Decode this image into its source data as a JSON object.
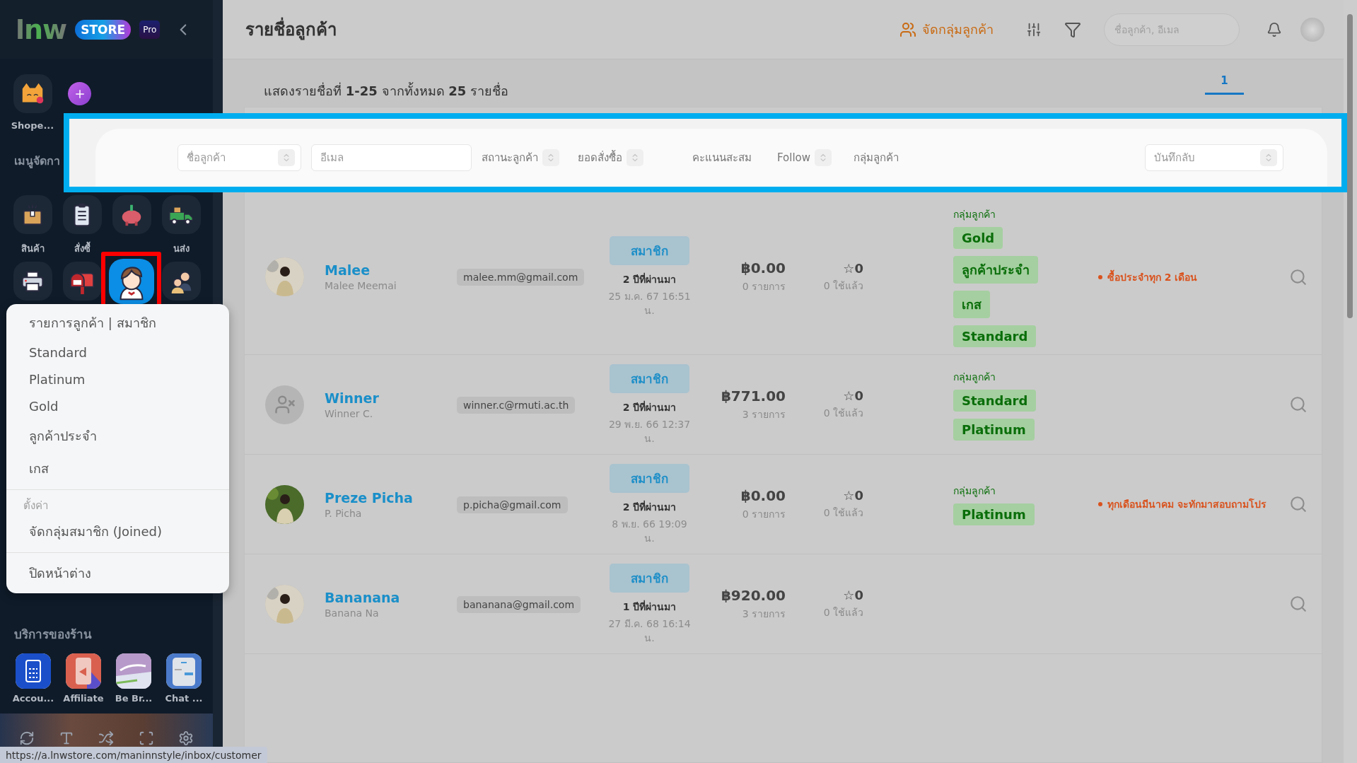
{
  "sidebar": {
    "logo": {
      "wordmark": "lnw",
      "badge": "STORE",
      "plan": "Pro"
    },
    "shops": [
      {
        "label": "Shope..."
      }
    ],
    "section_title": "เมนูจัดกา",
    "menu_icons": [
      {
        "kind": "box",
        "label": "สินค้า",
        "highlighted": false
      },
      {
        "kind": "clipboard",
        "label": "สั่งซื้",
        "highlighted": false
      },
      {
        "kind": "piggy",
        "highlighted": false
      },
      {
        "kind": "truck",
        "label": "นส่ง",
        "highlighted": false
      },
      {
        "kind": "printer",
        "highlighted": false
      },
      {
        "kind": "mailbox",
        "highlighted": false
      },
      {
        "kind": "customer",
        "highlighted": true
      },
      {
        "kind": "team",
        "highlighted": false
      }
    ],
    "services_title": "บริการของร้าน",
    "services": [
      {
        "kind": "calculator",
        "label": "Accou..."
      },
      {
        "kind": "megaphone",
        "label": "Affiliate"
      },
      {
        "kind": "brand",
        "label": "Be Br..."
      },
      {
        "kind": "chat",
        "label": "Chat ..."
      }
    ],
    "tools": [
      {
        "kind": "refresh"
      },
      {
        "kind": "text-size"
      },
      {
        "kind": "shuffle"
      },
      {
        "kind": "fullscreen"
      },
      {
        "kind": "settings"
      }
    ]
  },
  "popup_menu": {
    "items": [
      "รายการลูกค้า | สมาชิก",
      "Standard",
      "Platinum",
      "Gold",
      "ลูกค้าประจำ",
      "เกส"
    ],
    "section_title": "ตั้งค่า",
    "section_items": [
      "จัดกลุ่มสมาชิก (Joined)"
    ],
    "footer_item": "ปิดหน้าต่าง"
  },
  "status_url": "https://a.lnwstore.com/maninnstyle/inbox/customer",
  "header": {
    "title": "รายชื่อลูกค้า",
    "group_button": "จัดกลุ่มลูกค้า",
    "search_placeholder": "ชื่อลูกค้า, อีเมล"
  },
  "summary": "แสดงรายชื่อที่ **1-25** จากทั้งหมด **25** รายชื่อ",
  "pages": [
    {
      "label": "1",
      "selected": true
    }
  ],
  "columns_header": {
    "highlighted": true,
    "columns": [
      {
        "label": "ชื่อลูกค้า",
        "kind": "input",
        "sortable": true
      },
      {
        "label": "อีเมล",
        "kind": "input",
        "sortable": false
      },
      {
        "label": "สถานะลูกค้า",
        "kind": "label",
        "sortable": true
      },
      {
        "label": "ยอดสั่งซื้อ",
        "kind": "label",
        "sortable": true
      },
      {
        "label": "คะแนนสะสม",
        "kind": "label",
        "sortable": false
      },
      {
        "label": "Follow",
        "kind": "label",
        "sortable": true
      },
      {
        "label": "กลุ่มลูกค้า",
        "kind": "label",
        "sortable": false
      },
      {
        "label": "บันทึกลับ",
        "kind": "input",
        "sortable": true
      }
    ]
  },
  "rows": [
    {
      "avatar": {
        "kind": "picture"
      },
      "name": "Malee",
      "username": "Malee Meemai",
      "email": "malee.mm@gmail.com",
      "status": "สมาชิก",
      "since": "2 ปีที่ผ่านมา",
      "date": "25 ม.ค. 67 16:51 น.",
      "amount": "฿0.00",
      "orders": "0 รายการ",
      "points": "☆0",
      "used": "0 ใช้แล้ว",
      "group_label": "กลุ่มลูกค้า",
      "groups": [
        "Gold",
        "ลูกค้าประจำ",
        "เกส",
        "Standard"
      ],
      "note": "ซื้อประจำทุก 2 เดือน"
    },
    {
      "avatar": {
        "kind": "placeholder"
      },
      "name": "Winner",
      "username": "Winner C.",
      "email": "winner.c@rmuti.ac.th",
      "status": "สมาชิก",
      "since": "2 ปีที่ผ่านมา",
      "date": "29 พ.ย. 66 12:37 น.",
      "amount": "฿771.00",
      "orders": "3 รายการ",
      "points": "☆0",
      "used": "0 ใช้แล้ว",
      "group_label": "กลุ่มลูกค้า",
      "groups": [
        "Standard",
        "Platinum"
      ]
    },
    {
      "avatar": {
        "kind": "picture"
      },
      "name": "Preze Picha",
      "username": "P. Picha",
      "email": "p.picha@gmail.com",
      "status": "สมาชิก",
      "since": "2 ปีที่ผ่านมา",
      "date": "8 พ.ย. 66 19:09 น.",
      "amount": "฿0.00",
      "orders": "0 รายการ",
      "points": "☆0",
      "used": "0 ใช้แล้ว",
      "group_label": "กลุ่มลูกค้า",
      "groups": [
        "Platinum"
      ],
      "note": "ทุกเดือนมีนาคม จะทักมาสอบถามโปร"
    },
    {
      "avatar": {
        "kind": "picture"
      },
      "name": "Bananana",
      "username": "Banana Na",
      "email": "bananana@gmail.com",
      "status": "สมาชิก",
      "since": "1 ปีที่ผ่านมา",
      "date": "27 มี.ค. 68 16:14 น.",
      "amount": "฿920.00",
      "orders": "3 รายการ",
      "points": "☆0",
      "used": "0 ใช้แล้ว"
    }
  ]
}
